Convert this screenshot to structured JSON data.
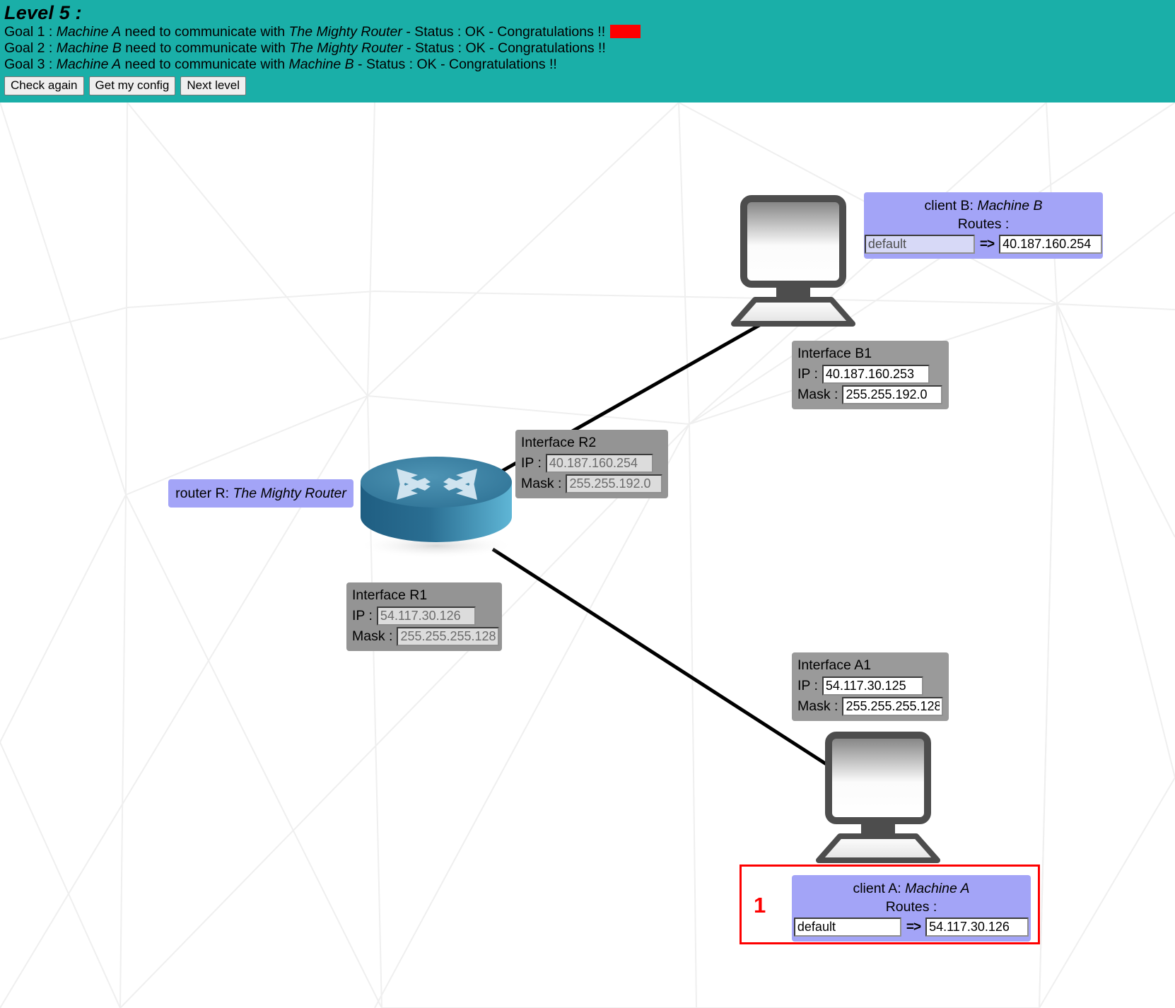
{
  "header": {
    "level_title": "Level 5 :",
    "goals": [
      {
        "prefix": "Goal 1 : ",
        "subject": "Machine A",
        "mid": " need to communicate with ",
        "target": "The Mighty Router",
        "suffix": " - Status : OK - Congratulations !!",
        "has_flag": true,
        "flag_color": "#fe0000"
      },
      {
        "prefix": "Goal 2 : ",
        "subject": "Machine B",
        "mid": " need to communicate with ",
        "target": "The Mighty Router",
        "suffix": " - Status : OK - Congratulations !!",
        "has_flag": false,
        "flag_color": ""
      },
      {
        "prefix": "Goal 3 : ",
        "subject": "Machine A",
        "mid": " need to communicate with ",
        "target": "Machine B",
        "suffix": " - Status : OK - Congratulations !!",
        "has_flag": false,
        "flag_color": ""
      }
    ],
    "buttons": [
      {
        "label": "Check again"
      },
      {
        "label": "Get my config"
      },
      {
        "label": "Next level"
      }
    ],
    "background_color": "#1aafa8"
  },
  "topology": {
    "client_b": {
      "name_prefix": "client B: ",
      "name": "Machine B",
      "routes_label": "Routes :",
      "route": {
        "destination": "default",
        "arrow": "=>",
        "gateway": "40.187.160.254"
      }
    },
    "interface_b1": {
      "title": "Interface B1",
      "ip_label": "IP :",
      "ip": "40.187.160.253",
      "mask_label": "Mask :",
      "mask": "255.255.192.0"
    },
    "interface_r2": {
      "title": "Interface R2",
      "ip_label": "IP :",
      "ip": "40.187.160.254",
      "mask_label": "Mask :",
      "mask": "255.255.192.0"
    },
    "router": {
      "name_prefix": "router R: ",
      "name": "The Mighty Router"
    },
    "interface_r1": {
      "title": "Interface R1",
      "ip_label": "IP :",
      "ip": "54.117.30.126",
      "mask_label": "Mask :",
      "mask": "255.255.255.128"
    },
    "interface_a1": {
      "title": "Interface A1",
      "ip_label": "IP :",
      "ip": "54.117.30.125",
      "mask_label": "Mask :",
      "mask": "255.255.255.128"
    },
    "client_a": {
      "name_prefix": "client A: ",
      "name": "Machine A",
      "routes_label": "Routes :",
      "route": {
        "destination": "default",
        "arrow": "=>",
        "gateway": "54.117.30.126"
      },
      "highlight_number": "1",
      "highlight_color": "#fe0000"
    }
  }
}
